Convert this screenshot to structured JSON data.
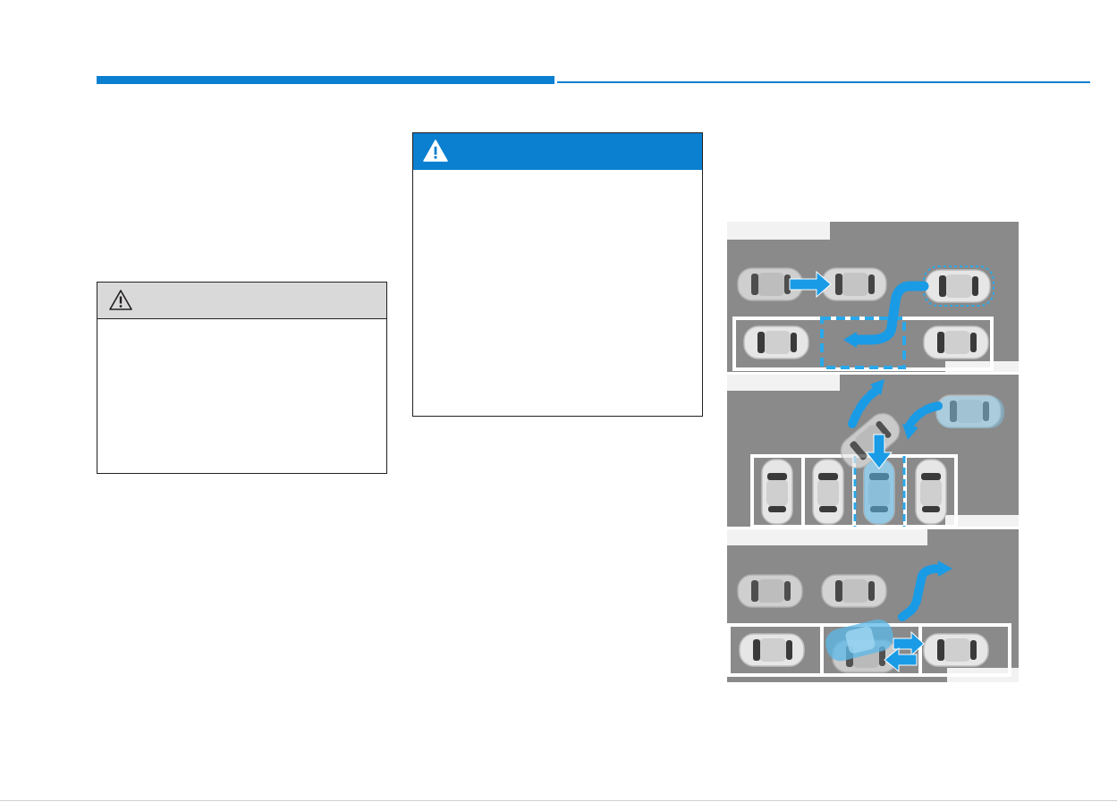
{
  "header": {
    "accent_color": "#0b7fd0"
  },
  "caution_box": {
    "icon": "caution-triangle-icon",
    "header_color": "#d9d9d9"
  },
  "warning_box": {
    "icon": "warning-triangle-icon",
    "header_color": "#0b7fd0"
  },
  "figure": {
    "panels": [
      {
        "scene": "parallel-parking",
        "icons": [
          "car-icon",
          "arrow-right-icon",
          "curved-path-arrow-icon",
          "parking-space-outline"
        ]
      },
      {
        "scene": "perpendicular-parking",
        "icons": [
          "car-icon",
          "curved-arrow-icon",
          "arrow-down-icon",
          "parking-space-outline"
        ]
      },
      {
        "scene": "parallel-exit",
        "icons": [
          "car-icon",
          "curved-path-arrow-icon",
          "arrow-right-icon",
          "arrow-left-icon"
        ]
      }
    ],
    "path_color": "#1a9be6",
    "ground_color": "#8a8a8a"
  }
}
